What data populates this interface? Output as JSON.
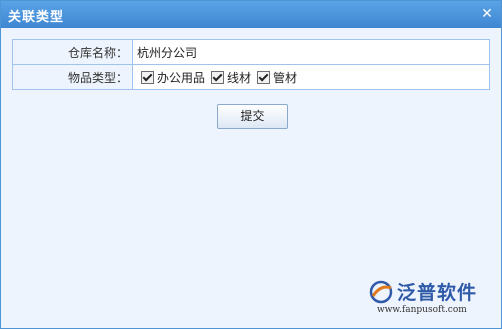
{
  "window": {
    "title": "关联类型",
    "close_icon": "close-icon"
  },
  "form": {
    "warehouse_label": "仓库名称：",
    "warehouse_value": "杭州分公司",
    "category_label": "物品类型：",
    "categories": [
      {
        "label": "办公用品",
        "checked": true
      },
      {
        "label": "线材",
        "checked": true
      },
      {
        "label": "管材",
        "checked": true
      }
    ]
  },
  "submit_label": "提交",
  "watermark": {
    "name": "泛普软件",
    "url": "www.fanpusoft.com"
  },
  "colors": {
    "title_bar": "#4a94dc",
    "border": "#9fc3ea",
    "background": "#eef4fd",
    "brand": "#2f5aa8"
  }
}
